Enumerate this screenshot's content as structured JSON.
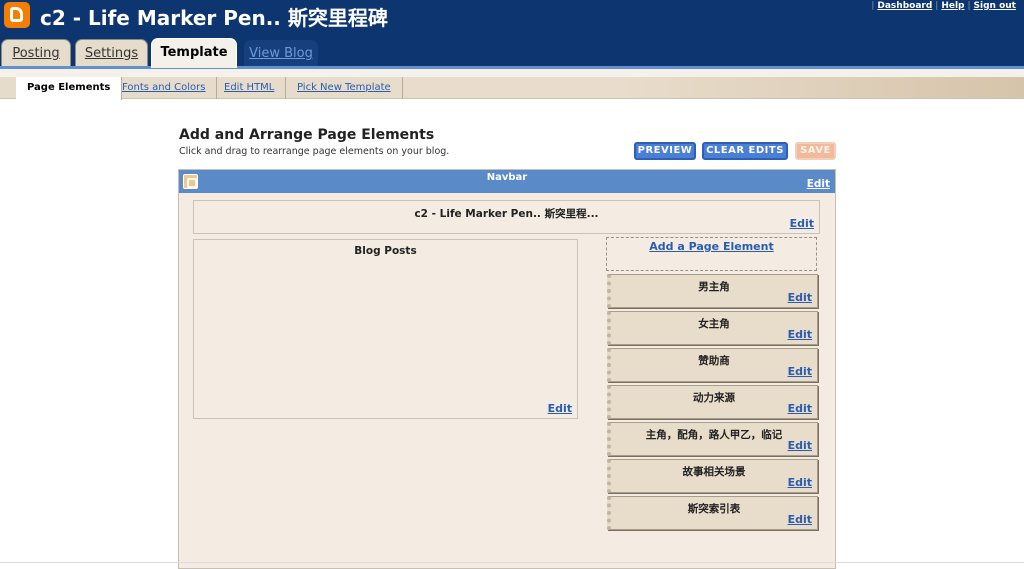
{
  "header": {
    "blog_title": "c2 - Life Marker Pen.. 斯突里程碑",
    "links": [
      "Dashboard",
      "Help",
      "Sign out"
    ]
  },
  "tabs": [
    "Posting",
    "Settings",
    "Template",
    "View Blog"
  ],
  "subtabs": [
    "Page Elements",
    "Fonts and Colors",
    "Edit HTML",
    "Pick New Template"
  ],
  "main": {
    "heading": "Add and Arrange Page Elements",
    "subheading": "Click and drag to rearrange page elements on your blog."
  },
  "buttons": {
    "preview": "PREVIEW",
    "clear": "CLEAR EDITS",
    "save": "SAVE"
  },
  "layout": {
    "navbar_title": "Navbar",
    "edit_label": "Edit",
    "header_title": "c2 - Life Marker Pen.. 斯突里程...",
    "posts_title": "Blog Posts",
    "add_element": "Add a Page Element",
    "widgets": [
      "男主角",
      "女主角",
      "赞助商",
      "动力来源",
      "主角，配角，路人甲乙，临记",
      "故事相关场景",
      "斯突索引表"
    ]
  },
  "colors": {
    "header_bg": "#0d356f",
    "accent_blue": "#5a8bc8",
    "panel_bg": "#f4ece2",
    "widget_bg": "#e8dcca",
    "logo_orange": "#f57d00"
  }
}
